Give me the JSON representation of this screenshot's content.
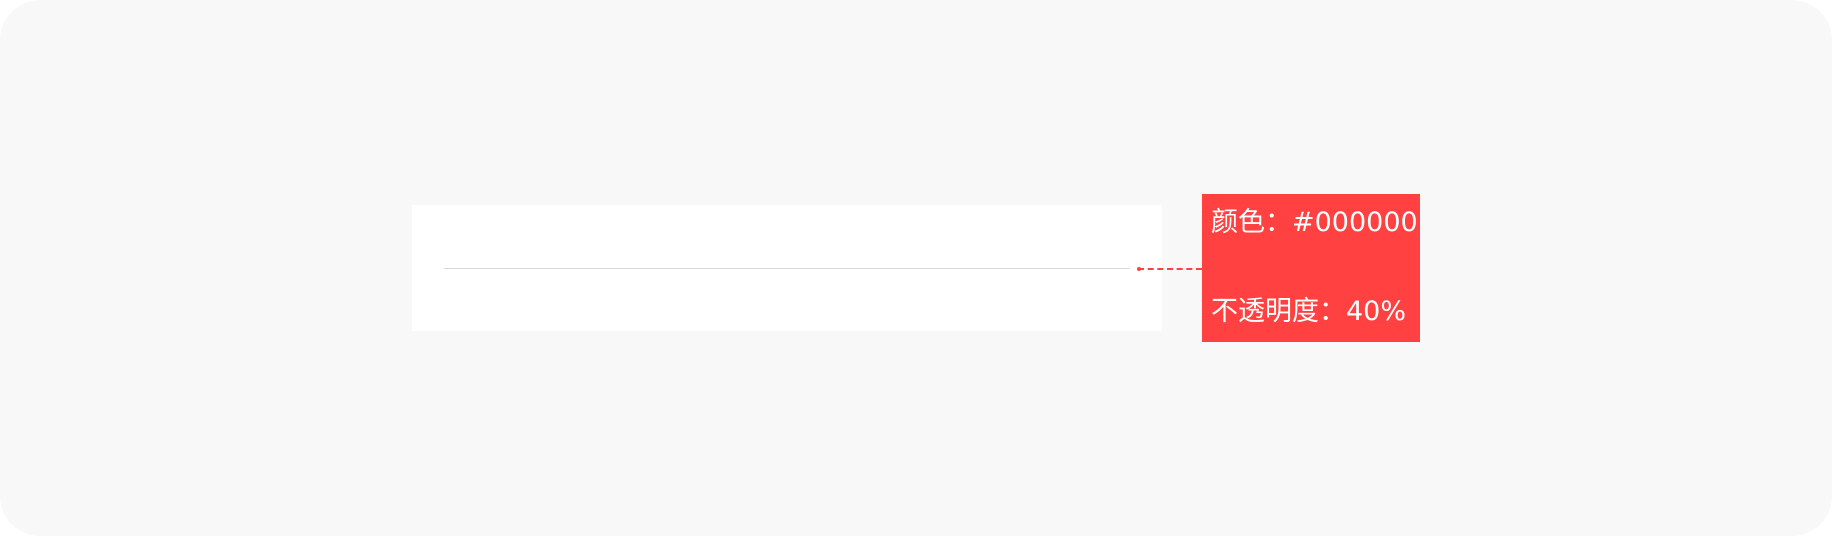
{
  "spec": {
    "color_label": "颜色：#000000",
    "opacity_label": "不透明度：40%"
  },
  "colors": {
    "annotation_bg": "#ff4141",
    "divider": "#000000",
    "canvas_bg": "#f8f8f8"
  }
}
